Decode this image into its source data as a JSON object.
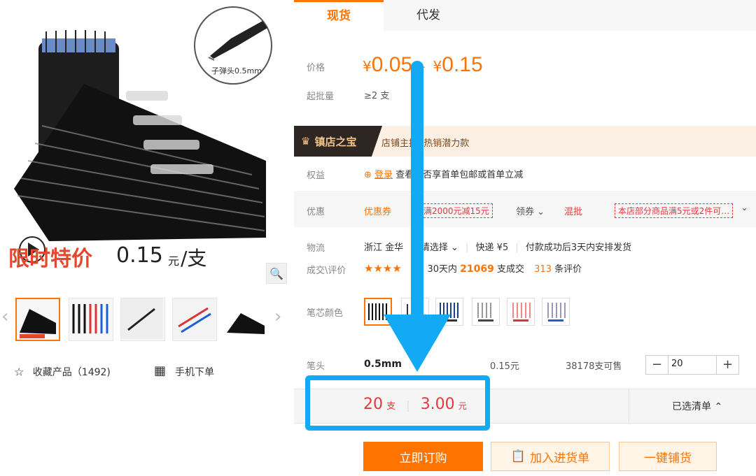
{
  "gallery": {
    "promo_text": "限时特价",
    "promo_price": "0.15",
    "promo_unit": "元",
    "promo_per": "/支",
    "nib_label": "子弹头0.5mm",
    "magnify_icon": "search-icon",
    "fav_label": "收藏产品（1492)",
    "mobile_label": "手机下单"
  },
  "tabs": [
    {
      "label": "现货"
    },
    {
      "label": "代发"
    }
  ],
  "price": {
    "label": "价格",
    "currency": "¥",
    "low": "0.05",
    "dash": "-",
    "high": "0.15",
    "moq_label": "起批量",
    "moq_value": "≥2 支"
  },
  "shop_badge": {
    "title": "镇店之宝",
    "desc": "店铺主推  热销潜力款"
  },
  "benefit": {
    "label": "权益",
    "login": "登录",
    "text": "查看是否享首单包邮或首单立减"
  },
  "discount": {
    "label": "优惠",
    "coupon": "优惠券",
    "coupon_tag": "满2000元减15元",
    "claim": "领券",
    "mix": "混批",
    "mix_tag": "本店部分商品满5元或2件可…"
  },
  "logistics": {
    "label": "物流",
    "origin": "浙江 金华",
    "select": "请选择",
    "express": "快递 ¥5",
    "ship": "付款成功后3天内安排发货"
  },
  "reviews": {
    "label": "成交\\评价",
    "stars": "★★★★",
    "period": "30天内",
    "deals": "21069",
    "deals_unit": "支成交",
    "reviews": "313",
    "reviews_unit": "条评价"
  },
  "colors": {
    "label": "笔芯颜色",
    "accent": "#ff7300",
    "highlight": "#13aaf5"
  },
  "sku": {
    "label": "笔头",
    "name": "0.5mm",
    "price": "0.15元",
    "stock": "38178支可售",
    "minus": "−",
    "qty": "20",
    "plus": "+"
  },
  "summary": {
    "qty": "20",
    "qty_unit": "支",
    "total": "3.00",
    "total_unit": "元",
    "list_label": "已选清单"
  },
  "buttons": {
    "buy": "立即订购",
    "cart": "加入进货单",
    "dist": "一键铺货"
  }
}
